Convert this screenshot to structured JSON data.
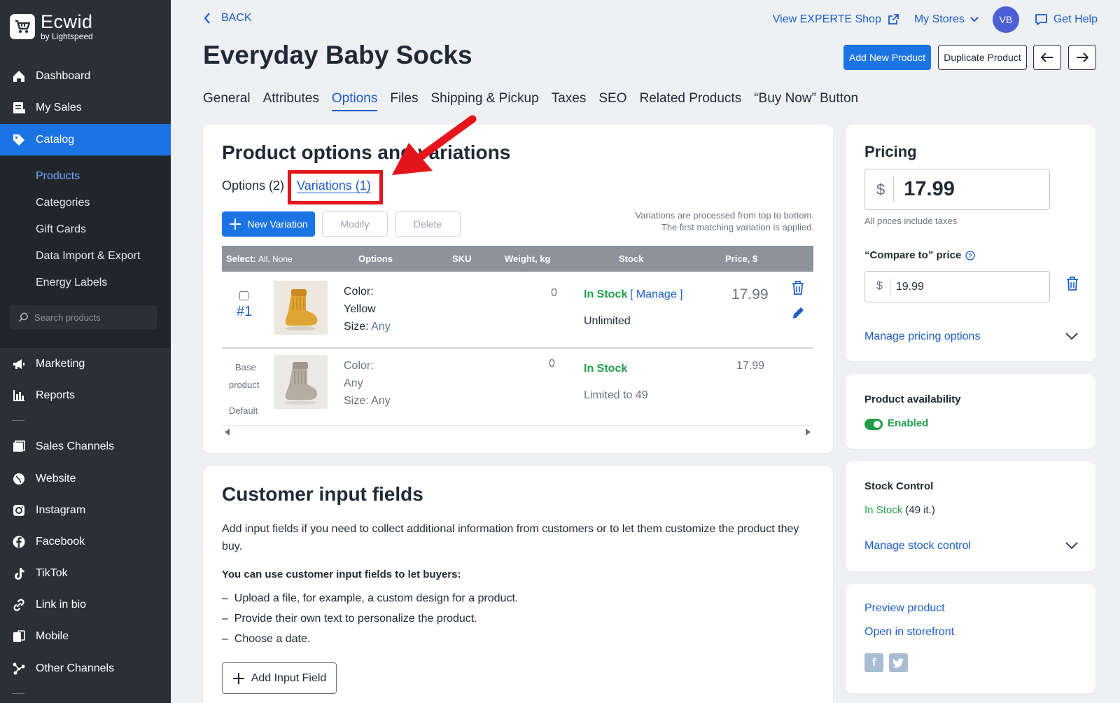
{
  "app": {
    "name": "Ecwid",
    "sub": "by Lightspeed"
  },
  "sidebar": {
    "items": [
      {
        "label": "Dashboard",
        "icon": "home-icon"
      },
      {
        "label": "My Sales",
        "icon": "sales-icon"
      },
      {
        "label": "Catalog",
        "icon": "tag-icon"
      }
    ],
    "catalog_sub": [
      "Products",
      "Categories",
      "Gift Cards",
      "Data Import & Export",
      "Energy Labels"
    ],
    "search_placeholder": "Search products",
    "items2": [
      {
        "label": "Marketing",
        "icon": "megaphone-icon"
      },
      {
        "label": "Reports",
        "icon": "bar-chart-icon"
      }
    ],
    "channels": [
      {
        "label": "Sales Channels",
        "icon": "store-icon"
      },
      {
        "label": "Website",
        "icon": "globe-icon"
      },
      {
        "label": "Instagram",
        "icon": "instagram-icon"
      },
      {
        "label": "Facebook",
        "icon": "facebook-icon"
      },
      {
        "label": "TikTok",
        "icon": "tiktok-icon"
      },
      {
        "label": "Link in bio",
        "icon": "link-icon"
      },
      {
        "label": "Mobile",
        "icon": "mobile-icon"
      },
      {
        "label": "Other Channels",
        "icon": "share-icon"
      }
    ]
  },
  "topbar": {
    "back": "BACK",
    "view_shop": "View EXPERTE Shop",
    "my_stores": "My Stores",
    "avatar": "VB",
    "get_help": "Get Help"
  },
  "page": {
    "title": "Everyday Baby Socks",
    "add_new": "Add New Product",
    "duplicate": "Duplicate Product"
  },
  "tabs": [
    "General",
    "Attributes",
    "Options",
    "Files",
    "Shipping & Pickup",
    "Taxes",
    "SEO",
    "Related Products",
    "“Buy Now” Button"
  ],
  "options_card": {
    "title": "Product options and variations",
    "subtabs": [
      "Options (2)",
      "Variations (1)"
    ],
    "new_variation": "New Variation",
    "modify": "Modify",
    "delete": "Delete",
    "note_line1": "Variations are processed from top to bottom.",
    "note_line2": "The first matching variation is applied.",
    "headers": {
      "select": "Select:",
      "select_opts": "All, None",
      "options": "Options",
      "sku": "SKU",
      "weight": "Weight, kg",
      "stock": "Stock",
      "price": "Price, $"
    },
    "rows": [
      {
        "id": "#1",
        "color_label": "Color:",
        "color": "Yellow",
        "size_label": "Size:",
        "size": "Any",
        "weight": "0",
        "stock": "In Stock",
        "manage": "[ Manage ]",
        "stock_detail": "Unlimited",
        "price": "17.99"
      },
      {
        "base1": "Base",
        "base2": "product",
        "base3": "Default",
        "color_label": "Color:",
        "color": "Any",
        "size_label": "Size:",
        "size": "Any",
        "weight": "0",
        "stock": "In Stock",
        "stock_detail": "Limited to 49",
        "price": "17.99"
      }
    ]
  },
  "input_card": {
    "title": "Customer input fields",
    "desc": "Add input fields if you need to collect additional information from customers or to let them customize the product they buy.",
    "bold": "You can use customer input fields to let buyers:",
    "bullets": [
      "Upload a file, for example, a custom design for a product.",
      "Provide their own text to personalize the product.",
      "Choose a date."
    ],
    "add_button": "Add Input Field"
  },
  "pricing": {
    "title": "Pricing",
    "currency": "$",
    "price": "17.99",
    "taxes_note": "All prices include taxes",
    "compare_label": "“Compare to” price",
    "compare_price": "19.99",
    "manage": "Manage pricing options"
  },
  "availability": {
    "title": "Product availability",
    "status": "Enabled"
  },
  "stock": {
    "title": "Stock Control",
    "status": "In Stock",
    "count": "(49 it.)",
    "manage": "Manage stock control"
  },
  "links": {
    "preview": "Preview product",
    "storefront": "Open in storefront"
  },
  "colors": {
    "accent": "#1b74e4",
    "link": "#1b5ec9",
    "green": "#1e9e4a",
    "highlight": "#e3151b",
    "sidebar": "#2b3037"
  }
}
